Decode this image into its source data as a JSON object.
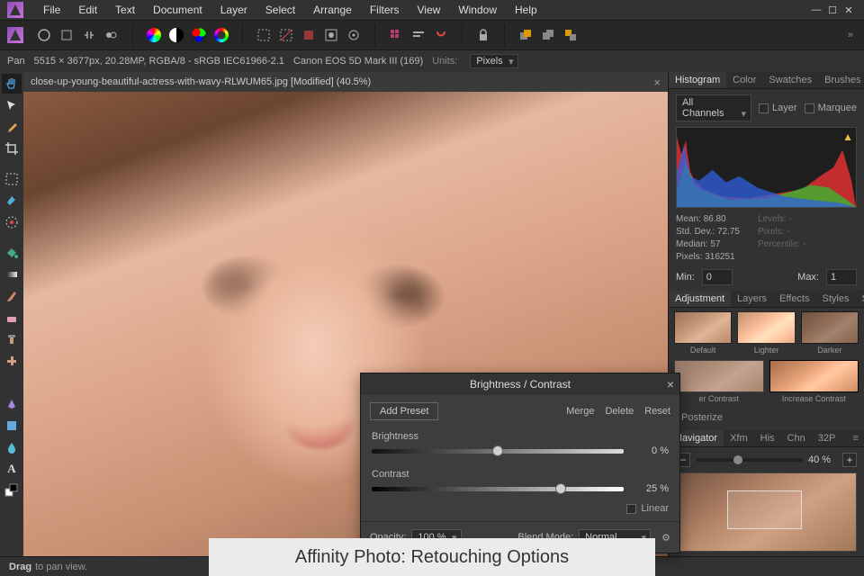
{
  "menu": [
    "File",
    "Edit",
    "Text",
    "Document",
    "Layer",
    "Select",
    "Arrange",
    "Filters",
    "View",
    "Window",
    "Help"
  ],
  "info": {
    "pan": "Pan",
    "dims": "5515 × 3677px, 20.28MP, RGBA/8 - sRGB IEC61966-2.1",
    "camera": "Canon EOS 5D Mark III (169)",
    "units_lbl": "Units:",
    "units_val": "Pixels"
  },
  "doc": {
    "tab": "close-up-young-beautiful-actress-with-wavy-RLWUM65.jpg [Modified] (40.5%)"
  },
  "panels": {
    "hist_tabs": [
      "Histogram",
      "Color",
      "Swatches",
      "Brushes"
    ],
    "channels": "All Channels",
    "layer": "Layer",
    "marquee": "Marquee",
    "stats": {
      "mean": "Mean: 86.80",
      "sd": "Std. Dev.: 72.75",
      "median": "Median: 57",
      "pixels": "Pixels: 316251",
      "levels": "Levels: -",
      "px2": "Pixels: -",
      "perc": "Percentile: -"
    },
    "min_lbl": "Min:",
    "min_val": "0",
    "max_lbl": "Max:",
    "max_val": "1",
    "adj_tabs": [
      "Adjustment",
      "Layers",
      "Effects",
      "Styles",
      "Stock"
    ],
    "thumbs1": [
      "Default",
      "Lighter",
      "Darker"
    ],
    "thumbs2": [
      "er Contrast",
      "Increase Contrast"
    ],
    "posterize": "Posterize",
    "nav_tabs": [
      "Navigator",
      "Xfm",
      "His",
      "Chn",
      "32P"
    ],
    "zoom": "40 %"
  },
  "dialog": {
    "title": "Brightness / Contrast",
    "add_preset": "Add Preset",
    "merge": "Merge",
    "delete": "Delete",
    "reset": "Reset",
    "brightness_lbl": "Brightness",
    "brightness_val": "0 %",
    "contrast_lbl": "Contrast",
    "contrast_val": "25 %",
    "linear": "Linear",
    "opacity_lbl": "Opacity:",
    "opacity_val": "100 %",
    "blend_lbl": "Blend Mode:",
    "blend_val": "Normal"
  },
  "status": {
    "drag": "Drag",
    "rest": "to pan view."
  },
  "caption": "Affinity Photo: Retouching Options"
}
